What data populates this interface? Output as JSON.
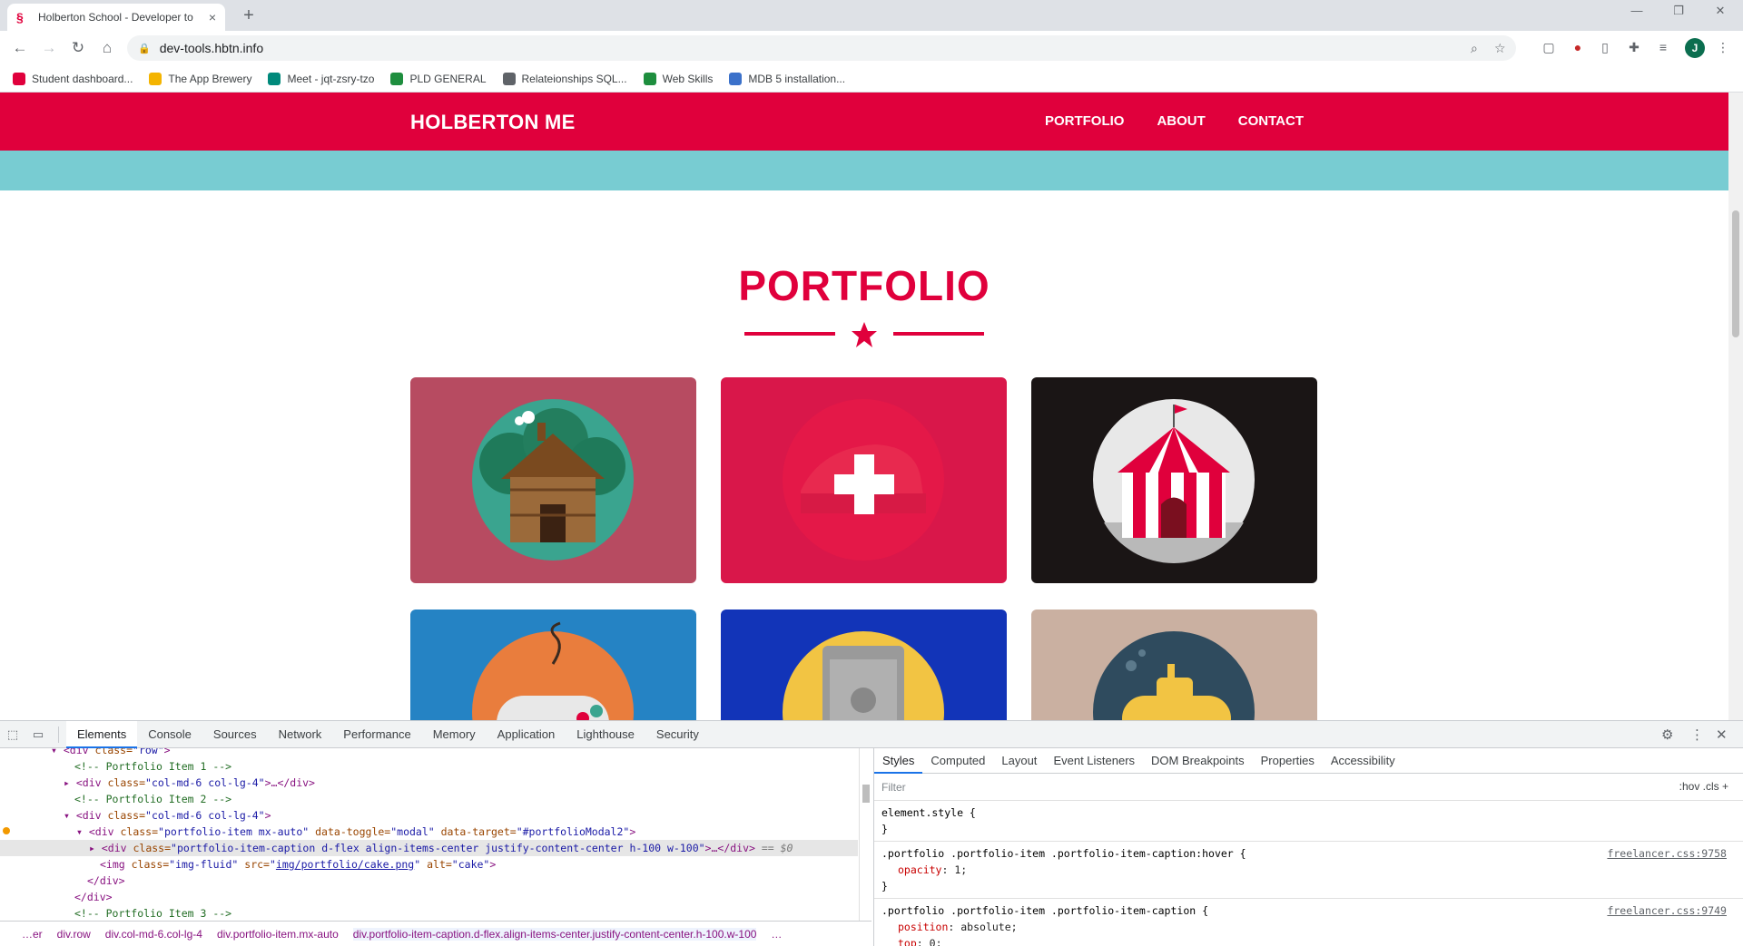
{
  "browser": {
    "tab_title": "Holberton School - Developer to",
    "tab_close": "×",
    "new_tab": "+",
    "url": "dev-tools.hbtn.info",
    "profile_initial": "J",
    "bookmarks": [
      {
        "label": "Student dashboard...",
        "color": "#e0003c",
        "icon": "holberton-icon"
      },
      {
        "label": "The App Brewery",
        "color": "#f4b400",
        "icon": "brewery-icon"
      },
      {
        "label": "Meet - jqt-zsry-tzo",
        "color": "#00897b",
        "icon": "meet-icon"
      },
      {
        "label": "PLD GENERAL",
        "color": "#1e8e3e",
        "icon": "meet-icon"
      },
      {
        "label": "Relateionships SQL...",
        "color": "#5f6368",
        "icon": "page-icon"
      },
      {
        "label": "Web Skills",
        "color": "#1e8e3e",
        "icon": "cloud-icon"
      },
      {
        "label": "MDB 5 installation...",
        "color": "#3b71ca",
        "icon": "mdb-icon"
      }
    ]
  },
  "site": {
    "brand": "HOLBERTON ME",
    "nav": [
      "PORTFOLIO",
      "ABOUT",
      "CONTACT"
    ],
    "section_title": "PORTFOLIO",
    "colors": {
      "primary": "#e0003c",
      "teal": "#78ccd2"
    },
    "tiles": [
      {
        "name": "cabin",
        "bg": "#b74b61"
      },
      {
        "name": "cake",
        "bg": "#d9174a"
      },
      {
        "name": "circus",
        "bg": "#1a1515"
      },
      {
        "name": "game",
        "bg": "#2583c4"
      },
      {
        "name": "safe",
        "bg": "#1234b8"
      },
      {
        "name": "submarine",
        "bg": "#cab0a1"
      }
    ]
  },
  "devtools": {
    "tabs": [
      "Elements",
      "Console",
      "Sources",
      "Network",
      "Performance",
      "Memory",
      "Application",
      "Lighthouse",
      "Security"
    ],
    "elements": {
      "l0": {
        "tag_open": "<div ",
        "attr": "class=",
        "val": "\"row\"",
        "close": ">"
      },
      "l1": "<!-- Portfolio Item 1 -->",
      "l2": {
        "tag": "<div ",
        "attr": "class=",
        "val": "\"col-md-6 col-lg-4\"",
        "rest": ">…</div>"
      },
      "l3": "<!-- Portfolio Item 2 -->",
      "l4": {
        "tag": "<div ",
        "attr": "class=",
        "val": "\"col-md-6 col-lg-4\"",
        "rest": ">"
      },
      "l5": {
        "tag": "<div ",
        "a1": "class=",
        "v1": "\"portfolio-item mx-auto\"",
        "a2": " data-toggle=",
        "v2": "\"modal\"",
        "a3": " data-target=",
        "v3": "\"#portfolioModal2\"",
        "rest": ">"
      },
      "l6": {
        "tag": "<div ",
        "attr": "class=",
        "val": "\"portfolio-item-caption d-flex align-items-center justify-content-center h-100 w-100\"",
        "rest": ">…</div>",
        "suffix": " == $0"
      },
      "l7": {
        "tag": "<img ",
        "a1": "class=",
        "v1": "\"img-fluid\"",
        "a2": " src=",
        "v2": "img/portfolio/cake.png",
        "a3": " alt=",
        "v3": "\"cake\"",
        "rest": ">"
      },
      "l8": "</div>",
      "l9": "</div>",
      "l10": "<!-- Portfolio Item 3 -->"
    },
    "breadcrumbs": [
      "…er",
      "div.row",
      "div.col-md-6.col-lg-4",
      "div.portfolio-item.mx-auto",
      "div.portfolio-item-caption.d-flex.align-items-center.justify-content-center.h-100.w-100",
      "…"
    ],
    "styles_tabs": [
      "Styles",
      "Computed",
      "Layout",
      "Event Listeners",
      "DOM Breakpoints",
      "Properties",
      "Accessibility"
    ],
    "filter_placeholder": "Filter",
    "filter_tools": ":hov  .cls  +",
    "rules": [
      {
        "selector": "element.style {",
        "src": "",
        "props": [],
        "close": "}"
      },
      {
        "selector": ".portfolio .portfolio-item .portfolio-item-caption:hover {",
        "src": "freelancer.css:9758",
        "props": [
          {
            "k": "opacity",
            "v": "1;"
          }
        ],
        "close": "}"
      },
      {
        "selector": ".portfolio .portfolio-item .portfolio-item-caption {",
        "src": "freelancer.css:9749",
        "props": [
          {
            "k": "position",
            "v": "absolute;"
          },
          {
            "k": "top",
            "v": "0;"
          }
        ],
        "close": ""
      }
    ]
  }
}
